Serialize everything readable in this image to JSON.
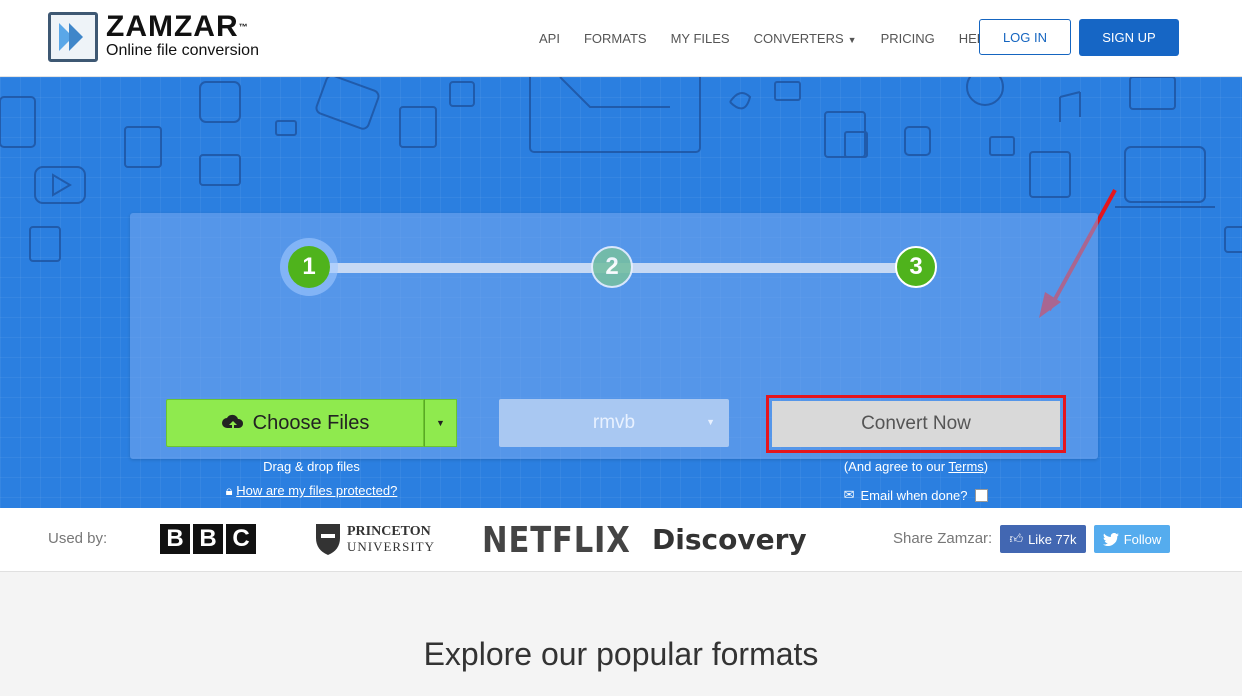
{
  "brand": {
    "name": "ZAMZAR",
    "tm": "™",
    "tagline": "Online file conversion"
  },
  "nav": {
    "items": [
      {
        "label": "API"
      },
      {
        "label": "FORMATS"
      },
      {
        "label": "MY FILES"
      },
      {
        "label": "CONVERTERS"
      },
      {
        "label": "PRICING"
      },
      {
        "label": "HELP"
      }
    ],
    "login_label": "LOG IN",
    "signup_label": "SIGN UP"
  },
  "converter": {
    "steps": [
      "1",
      "2",
      "3"
    ],
    "choose_files_label": "Choose Files",
    "drag_drop_hint": "Drag & drop files",
    "protected_link": "How are my files protected?",
    "format_selected": "rmvb",
    "convert_label": "Convert Now",
    "agree_prefix": "(And agree to our ",
    "terms_link": "Terms",
    "agree_suffix": ")",
    "email_label": "Email when done?"
  },
  "used_by": {
    "label": "Used by:",
    "bbc_letters": [
      "B",
      "B",
      "C"
    ],
    "princeton_line1": "PRINCETON",
    "princeton_line2": "UNIVERSITY",
    "netflix": "NETFLIX",
    "discovery": "Discovery"
  },
  "share": {
    "label": "Share Zamzar:",
    "like_label": "Like 77k",
    "follow_label": "Follow"
  },
  "explore_heading": "Explore our popular formats",
  "colors": {
    "hero_blue": "#2b7fe0",
    "step_green": "#4fb31c",
    "choose_green": "#8fea4e",
    "annotation_red": "#e5151d",
    "signup_blue": "#1666c5"
  }
}
